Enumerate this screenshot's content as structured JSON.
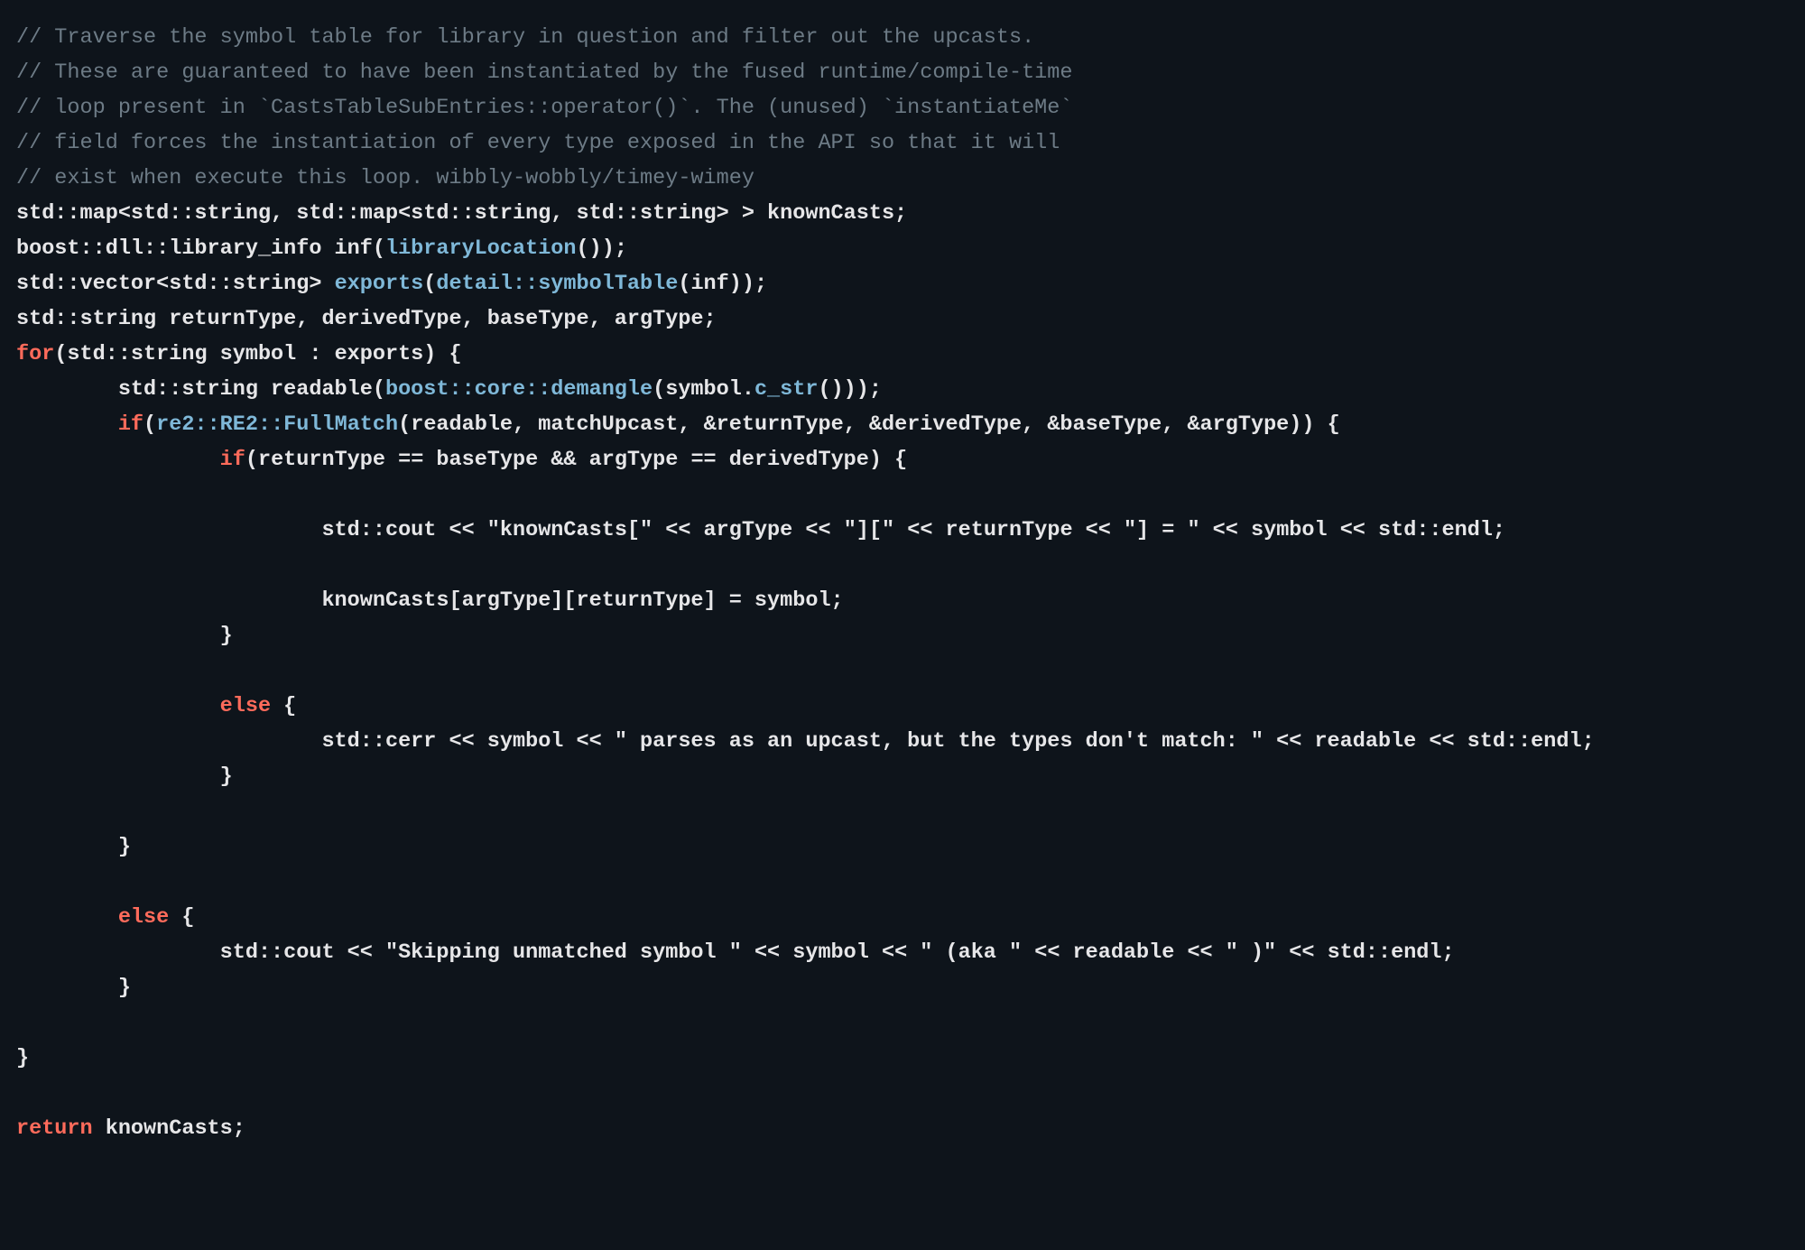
{
  "code": {
    "lines": [
      {
        "cls": "c",
        "text": "// Traverse the symbol table for library in question and filter out the upcasts."
      },
      {
        "cls": "c",
        "text": "// These are guaranteed to have been instantiated by the fused runtime/compile-time"
      },
      {
        "cls": "c",
        "text": "// loop present in `CastsTableSubEntries::operator()`. The (unused) `instantiateMe`"
      },
      {
        "cls": "c",
        "text": "// field forces the instantiation of every type exposed in the API so that it will"
      },
      {
        "cls": "c",
        "text": "// exist when execute this loop. wibbly-wobbly/timey-wimey"
      }
    ],
    "l6": {
      "a": "std::map<std::string, std::map<std::string, std::string> > knownCasts;"
    },
    "l7": {
      "a": "boost::dll::library_info inf(",
      "b": "libraryLocation",
      "c": "());"
    },
    "l8": {
      "a": "std::vector<std::string> ",
      "b": "exports",
      "c": "(",
      "d": "detail::symbolTable",
      "e": "(inf));"
    },
    "l9": {
      "a": "std::string returnType, derivedType, baseType, argType;"
    },
    "l10": {
      "a": "for",
      "b": "(std::string symbol : exports) {"
    },
    "l11": {
      "a": "        std::string readable(",
      "b": "boost::core::demangle",
      "c": "(symbol.",
      "d": "c_str",
      "e": "()));"
    },
    "l12": {
      "a": "        ",
      "b": "if",
      "c": "(",
      "d": "re2::RE2::FullMatch",
      "e": "(readable, matchUpcast, &returnType, &derivedType, &baseType, &argType)) {"
    },
    "l13": {
      "a": "                ",
      "b": "if",
      "c": "(returnType == baseType && argType == derivedType) {"
    },
    "l14": {
      "a": ""
    },
    "l15": {
      "a": "                        std::cout << ",
      "b": "\"knownCasts[\"",
      "c": " << argType << ",
      "d": "\"][\"",
      "e": " << returnType << ",
      "f": "\"] = \"",
      "g": " << symbol << std::endl;"
    },
    "l16": {
      "a": ""
    },
    "l17": {
      "a": "                        knownCasts[argType][returnType] = symbol;"
    },
    "l18": {
      "a": "                }"
    },
    "l19": {
      "a": ""
    },
    "l20": {
      "a": "                ",
      "b": "else",
      "c": " {"
    },
    "l21": {
      "a": "                        std::cerr << symbol << ",
      "b": "\" parses as an upcast, but the types don't match: \"",
      "c": " << readable << std::endl;"
    },
    "l22": {
      "a": "                }"
    },
    "l23": {
      "a": ""
    },
    "l24": {
      "a": "        }"
    },
    "l25": {
      "a": ""
    },
    "l26": {
      "a": "        ",
      "b": "else",
      "c": " {"
    },
    "l27": {
      "a": "                std::cout << ",
      "b": "\"Skipping unmatched symbol \"",
      "c": " << symbol << ",
      "d": "\" (aka \"",
      "e": " << readable << ",
      "f": "\" )\"",
      "g": " << std::endl;"
    },
    "l28": {
      "a": "        }"
    },
    "l29": {
      "a": ""
    },
    "l30": {
      "a": "}"
    },
    "l31": {
      "a": ""
    },
    "l32": {
      "a": "return",
      "b": " knownCasts;"
    }
  }
}
